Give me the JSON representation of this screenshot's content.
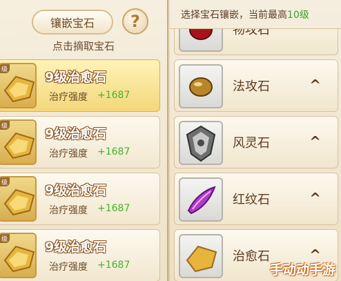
{
  "left_panel": {
    "tab_label": "镶嵌宝石",
    "help_symbol": "?",
    "hint": "点击摘取宝石",
    "gems": [
      {
        "badge": "级",
        "name": "9级治愈石",
        "stat_label": "治疗强度",
        "stat_value": "+1687",
        "selected": true
      },
      {
        "badge": "级",
        "name": "9级治愈石",
        "stat_label": "治疗强度",
        "stat_value": "+1687",
        "selected": false
      },
      {
        "badge": "级",
        "name": "9级治愈石",
        "stat_label": "治疗强度",
        "stat_value": "+1687",
        "selected": false
      },
      {
        "badge": "级",
        "name": "9级治愈石",
        "stat_label": "治疗强度",
        "stat_value": "+1687",
        "selected": false
      }
    ]
  },
  "right_panel": {
    "header_prefix": "选择宝石镶嵌，当前最高",
    "header_level": "10级",
    "types": [
      {
        "name": "物攻石",
        "icon": "red-gem-icon"
      },
      {
        "name": "法攻石",
        "icon": "amber-gem-icon"
      },
      {
        "name": "风灵石",
        "icon": "silver-shield-gem-icon"
      },
      {
        "name": "红纹石",
        "icon": "purple-feather-gem-icon"
      },
      {
        "name": "治愈石",
        "icon": "gold-gem-icon"
      }
    ],
    "chevron": "^"
  },
  "watermark": "手动动手游",
  "colors": {
    "accent_green": "#45b22a",
    "selected_gold": "#f3d77a",
    "text_brown": "#5a3b1f"
  }
}
